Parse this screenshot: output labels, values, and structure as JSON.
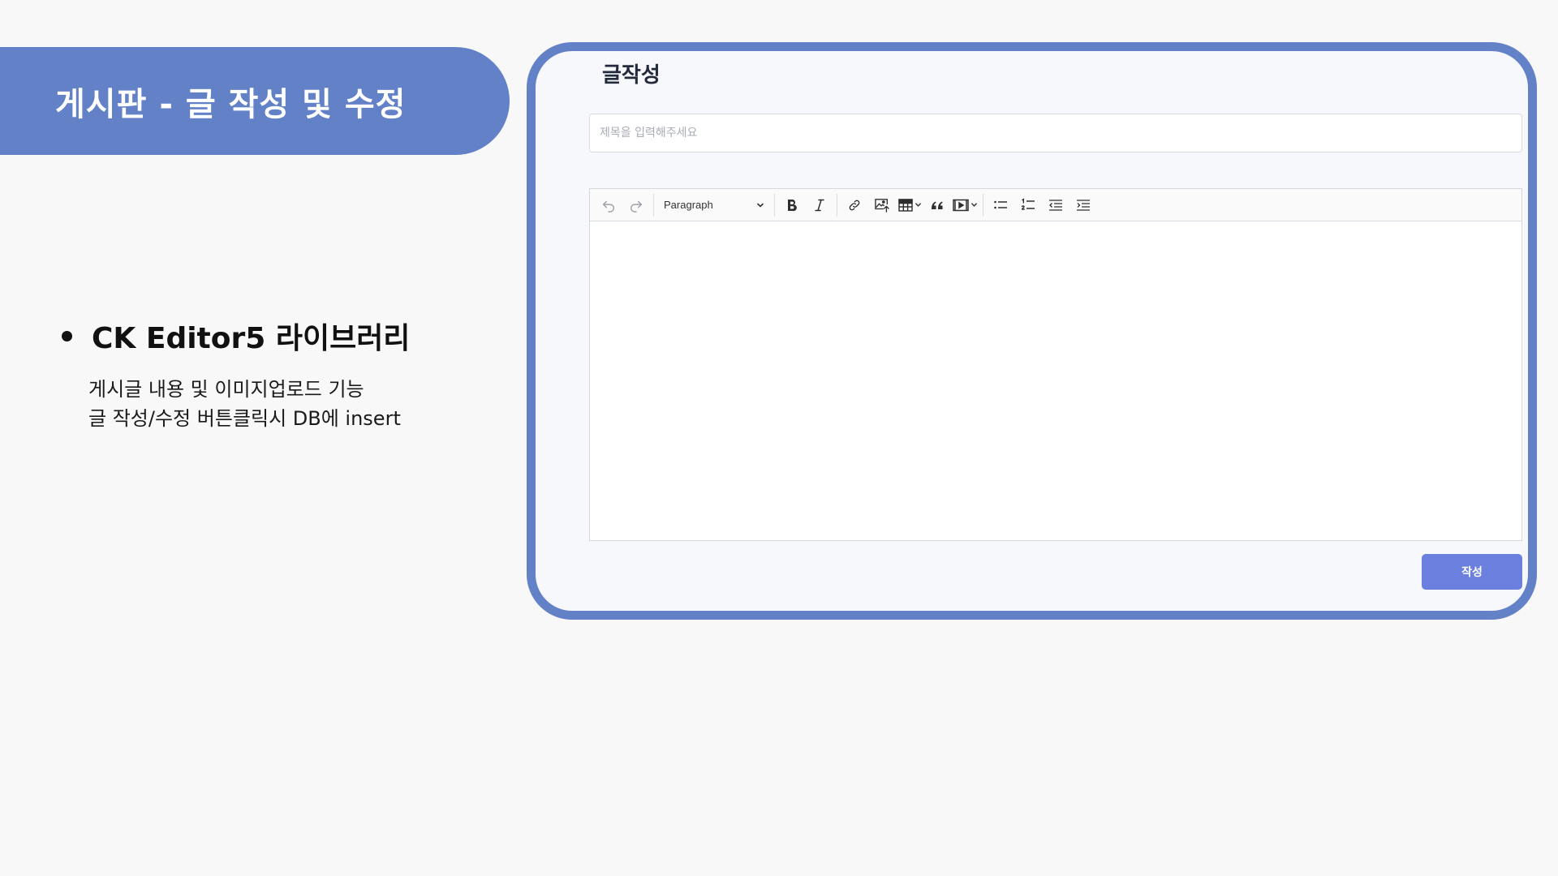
{
  "slide": {
    "title": "게시판 - 글 작성 및 수정",
    "bullet_heading": "CK Editor5 라이브러리",
    "bullet_lines": [
      "게시글 내용 및 이미지업로드 기능",
      "글 작성/수정 버튼클릭시 DB에 insert"
    ]
  },
  "page": {
    "heading": "글작성",
    "title_placeholder": "제목을 입력해주세요",
    "submit_label": "작성"
  },
  "editor": {
    "heading_select_value": "Paragraph",
    "toolbar_icons": [
      "undo-icon",
      "redo-icon",
      "bold-icon",
      "italic-icon",
      "link-icon",
      "image-upload-icon",
      "table-icon",
      "block-quote-icon",
      "media-embed-icon",
      "bulleted-list-icon",
      "numbered-list-icon",
      "outdent-icon",
      "indent-icon"
    ]
  },
  "colors": {
    "accent": "#6381c7",
    "button": "#6b7fde",
    "background": "#f8f8f9"
  }
}
